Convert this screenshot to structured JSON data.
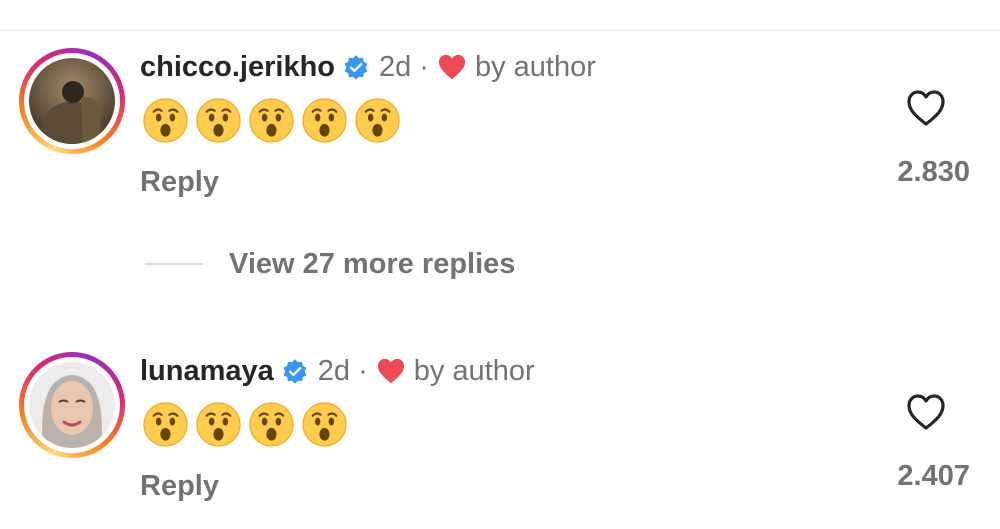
{
  "comments": [
    {
      "username": "chicco.jerikho",
      "verified": true,
      "time": "2d",
      "separator": "·",
      "liked_by_author": "by author",
      "emoji_count": 5,
      "emoji_icon": "astonished-face-emoji",
      "reply_label": "Reply",
      "like_count": "2.830"
    },
    {
      "username": "lunamaya",
      "verified": true,
      "time": "2d",
      "separator": "·",
      "liked_by_author": "by author",
      "emoji_count": 4,
      "emoji_icon": "astonished-face-emoji",
      "reply_label": "Reply",
      "like_count": "2.407"
    }
  ],
  "view_more_replies": "View 27 more replies",
  "colors": {
    "text_primary": "#262626",
    "text_secondary": "#737373",
    "verified_blue": "#3897f0",
    "heart_red": "#ed4956",
    "emoji_yellow": "#ffcc4d"
  }
}
